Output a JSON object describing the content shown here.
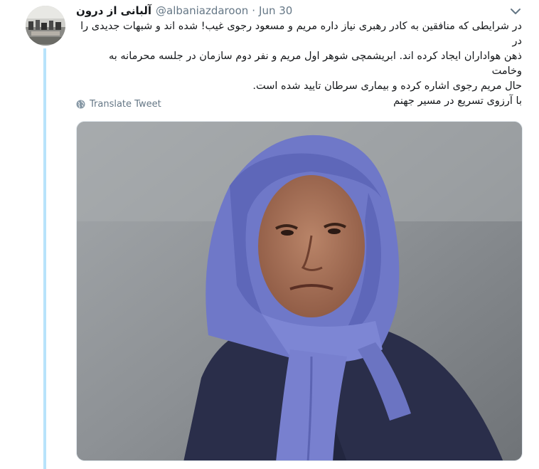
{
  "tweet": {
    "display_name": "آلبانی از درون",
    "handle": "@albaniazdaroon",
    "separator": "·",
    "date": "Jun 30",
    "text_lines": [
      "در شرایطی که منافقین به کادر رهبری نیاز داره مریم و مسعود رجوی غیب! شده اند و شبهات جدیدی را در",
      "ذهن هواداران ایجاد کرده اند. ابریشمچی شوهر اول مریم و نفر دوم سازمان در جلسه محرمانه به وخامت",
      "حال مریم رجوی اشاره کرده و بیماری سرطان تایید شده است.",
      "با آرزوی تسریع در مسیر جهنم"
    ],
    "translate_label": "Translate Tweet"
  },
  "icons": {
    "caret": "chevron-down-icon",
    "globe": "globe-icon"
  },
  "colors": {
    "secondary_text": "#657786",
    "thread_line": "#b8e3fb",
    "hijab": "#6f78c8",
    "coat": "#2a2e4a"
  }
}
